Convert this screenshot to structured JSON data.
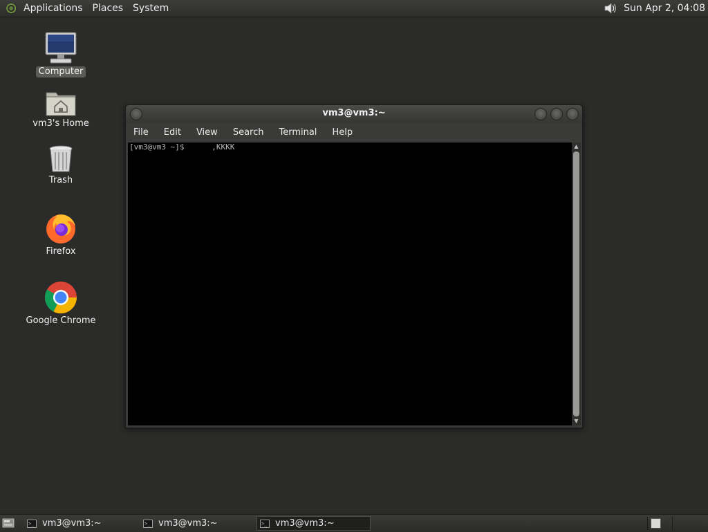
{
  "top_panel": {
    "menus": [
      "Applications",
      "Places",
      "System"
    ],
    "clock": "Sun Apr  2, 04:08",
    "icons": {
      "logo": "distro-logo-icon",
      "volume": "volume-icon"
    }
  },
  "desktop": {
    "icons": [
      {
        "label": "Computer",
        "icon": "computer-icon",
        "selected": true
      },
      {
        "label": "vm3's Home",
        "icon": "home-folder-icon"
      },
      {
        "label": "Trash",
        "icon": "trash-icon"
      },
      {
        "label": "Firefox",
        "icon": "firefox-icon"
      },
      {
        "label": "Google Chrome",
        "icon": "chrome-icon"
      }
    ]
  },
  "terminal": {
    "title": "vm3@vm3:~",
    "menu": [
      "File",
      "Edit",
      "View",
      "Search",
      "Terminal",
      "Help"
    ],
    "line": "[vm3@vm3 ~]$      ,KKKK"
  },
  "bottom_panel": {
    "tasks": [
      {
        "label": "vm3@vm3:~"
      },
      {
        "label": "vm3@vm3:~"
      },
      {
        "label": "vm3@vm3:~",
        "active": true
      }
    ],
    "icons": {
      "show_desktop": "show-desktop-icon",
      "task": "terminal-icon"
    }
  }
}
